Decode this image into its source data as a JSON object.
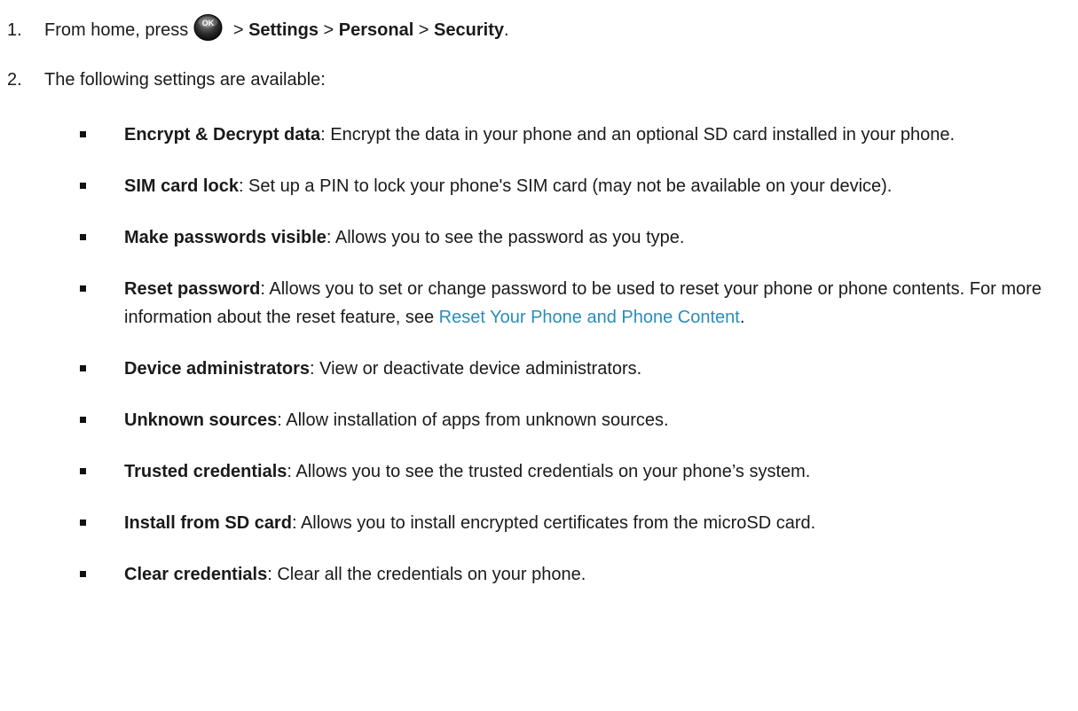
{
  "steps": [
    {
      "number": "1.",
      "prefix": "From home, press",
      "icon": "ok-button-icon",
      "icon_label": "OK",
      "path": [
        {
          "sep": " > ",
          "label": "Settings"
        },
        {
          "sep": " > ",
          "label": "Personal"
        },
        {
          "sep": " > ",
          "label": "Security"
        }
      ],
      "suffix": "."
    },
    {
      "number": "2.",
      "text": "The following settings are available:"
    }
  ],
  "settings": [
    {
      "name": "Encrypt & Decrypt data",
      "desc": ": Encrypt the data in your phone and an optional SD card installed in your phone."
    },
    {
      "name": "SIM card lock",
      "desc": ": Set up a PIN to lock your phone's SIM card (may not be available on your device)."
    },
    {
      "name": "Make passwords visible",
      "desc": ": Allows you to see the password as you type."
    },
    {
      "name": "Reset password",
      "desc": ": Allows you to set or change password to be used to reset your phone or phone contents. For more information about the reset feature, see ",
      "link": "Reset Your Phone and Phone Content",
      "after": "."
    },
    {
      "name": "Device administrators",
      "desc": ": View or deactivate device administrators."
    },
    {
      "name": "Unknown sources",
      "desc": ": Allow installation of apps from unknown sources."
    },
    {
      "name": "Trusted credentials",
      "desc": ": Allows you to see the trusted credentials on your phone’s system."
    },
    {
      "name": "Install from SD card",
      "desc": ": Allows you to install encrypted certificates from the microSD card."
    },
    {
      "name": "Clear credentials",
      "desc": ": Clear all the credentials on your phone."
    }
  ],
  "colors": {
    "text": "#1a1a1a",
    "link": "#2a8db8"
  }
}
